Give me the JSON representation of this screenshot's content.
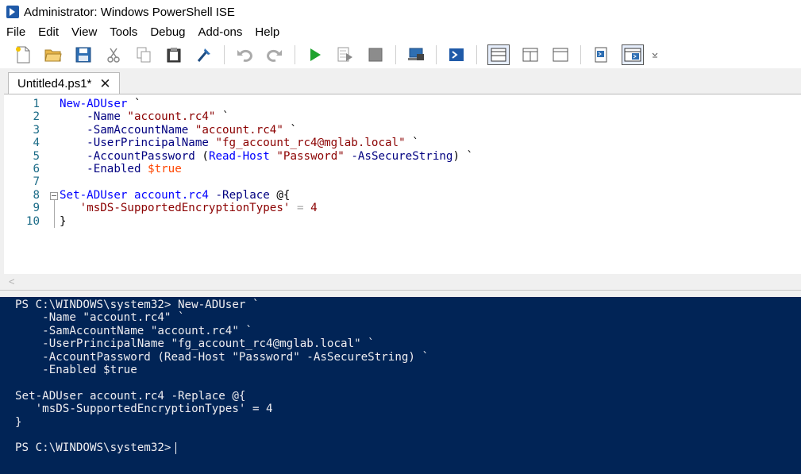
{
  "window": {
    "title": "Administrator: Windows PowerShell ISE"
  },
  "menu": [
    "File",
    "Edit",
    "View",
    "Tools",
    "Debug",
    "Add-ons",
    "Help"
  ],
  "toolbar": {
    "buttons": [
      "new-file",
      "open-folder",
      "save",
      "cut",
      "copy",
      "paste",
      "clear-console",
      "undo",
      "redo",
      "run-script",
      "run-selection",
      "stop",
      "remote-powershell-tab",
      "start-powershell",
      "show-script-pane-top",
      "show-script-pane-right",
      "show-script-pane-maximized",
      "show-command-window",
      "show-command-add-on",
      "customize"
    ]
  },
  "tab": {
    "label": "Untitled4.ps1*",
    "close": "✕"
  },
  "editor": {
    "line_numbers": [
      "1",
      "2",
      "3",
      "4",
      "5",
      "6",
      "7",
      "8",
      "9",
      "10"
    ],
    "lines": [
      [
        {
          "t": "New-ADUser",
          "c": "cmd"
        },
        {
          "t": " `",
          "c": "plain"
        }
      ],
      [
        {
          "t": "    -Name",
          "c": "param"
        },
        {
          "t": " ",
          "c": "plain"
        },
        {
          "t": "\"account.rc4\"",
          "c": "str"
        },
        {
          "t": " `",
          "c": "plain"
        }
      ],
      [
        {
          "t": "    -SamAccountName",
          "c": "param"
        },
        {
          "t": " ",
          "c": "plain"
        },
        {
          "t": "\"account.rc4\"",
          "c": "str"
        },
        {
          "t": " `",
          "c": "plain"
        }
      ],
      [
        {
          "t": "    -UserPrincipalName",
          "c": "param"
        },
        {
          "t": " ",
          "c": "plain"
        },
        {
          "t": "\"fg_account_rc4@mglab.local\"",
          "c": "str"
        },
        {
          "t": " `",
          "c": "plain"
        }
      ],
      [
        {
          "t": "    -AccountPassword",
          "c": "param"
        },
        {
          "t": " (",
          "c": "plain"
        },
        {
          "t": "Read-Host",
          "c": "cmd"
        },
        {
          "t": " ",
          "c": "plain"
        },
        {
          "t": "\"Password\"",
          "c": "str"
        },
        {
          "t": " ",
          "c": "plain"
        },
        {
          "t": "-AsSecureString",
          "c": "param"
        },
        {
          "t": ") `",
          "c": "plain"
        }
      ],
      [
        {
          "t": "    -Enabled",
          "c": "param"
        },
        {
          "t": " ",
          "c": "plain"
        },
        {
          "t": "$true",
          "c": "var"
        }
      ],
      [],
      [
        {
          "t": "Set-ADUser",
          "c": "cmd"
        },
        {
          "t": " ",
          "c": "plain"
        },
        {
          "t": "account.rc4",
          "c": "cmd"
        },
        {
          "t": " ",
          "c": "plain"
        },
        {
          "t": "-Replace",
          "c": "param"
        },
        {
          "t": " @{",
          "c": "plain"
        }
      ],
      [
        {
          "t": "   ",
          "c": "plain"
        },
        {
          "t": "'msDS-SupportedEncryptionTypes'",
          "c": "str"
        },
        {
          "t": " ",
          "c": "plain"
        },
        {
          "t": "=",
          "c": "op"
        },
        {
          "t": " ",
          "c": "plain"
        },
        {
          "t": "4",
          "c": "str"
        }
      ],
      [
        {
          "t": "}",
          "c": "plain"
        }
      ]
    ]
  },
  "hscroll": {
    "left_arrow": "<"
  },
  "console": {
    "lines": [
      "PS C:\\WINDOWS\\system32> New-ADUser `",
      "    -Name \"account.rc4\" `",
      "    -SamAccountName \"account.rc4\" `",
      "    -UserPrincipalName \"fg_account_rc4@mglab.local\" `",
      "    -AccountPassword (Read-Host \"Password\" -AsSecureString) `",
      "    -Enabled $true",
      "",
      "Set-ADUser account.rc4 -Replace @{",
      "   'msDS-SupportedEncryptionTypes' = 4",
      "}",
      "",
      "PS C:\\WINDOWS\\system32>"
    ]
  }
}
